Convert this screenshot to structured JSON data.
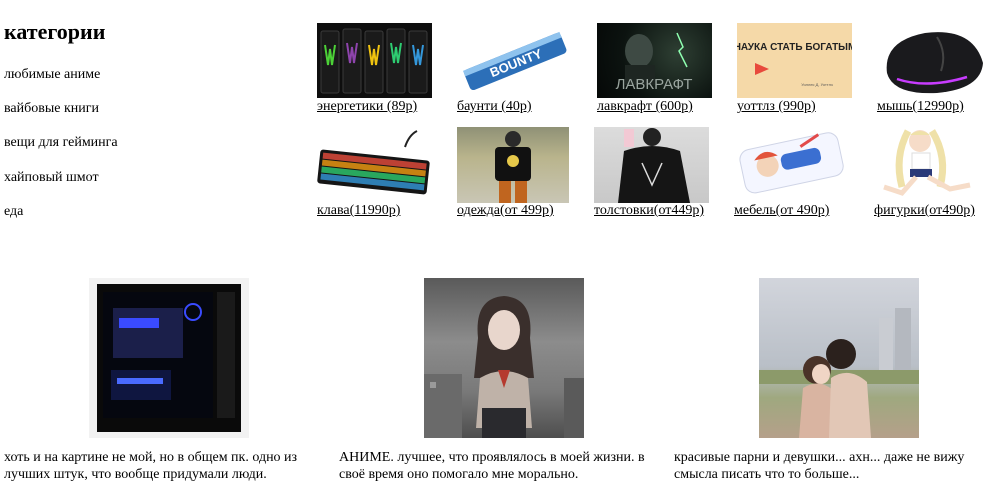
{
  "sidebar": {
    "title": "категории",
    "categories": [
      "любимые аниме",
      "вайбовые книги",
      "вещи для гейминга",
      "хайповый шмот",
      "еда"
    ]
  },
  "products": [
    {
      "label": "энергетики (89р)",
      "image": "energy-drink-cans"
    },
    {
      "label": "баунти (40р)",
      "image": "bounty-bar"
    },
    {
      "label": "лавкрафт (600р)",
      "image": "lovecraft-portrait"
    },
    {
      "label": "уоттлз (990р)",
      "image": "book-cover"
    },
    {
      "label": "мышь(12990р)",
      "image": "gaming-mouse"
    },
    {
      "label": "клава(11990р)",
      "image": "rgb-keyboard"
    },
    {
      "label": "одежда(от 499р)",
      "image": "streetwear-outfit"
    },
    {
      "label": "толстовки(от449р)",
      "image": "black-hoodie"
    },
    {
      "label": "мебель(от 490р)",
      "image": "anime-pillow"
    },
    {
      "label": "фигурки(от490р)",
      "image": "anime-figurine"
    }
  ],
  "book_cover_text": {
    "title": "НАУКА СТАТЬ БОГАТЫМ",
    "author": "Уоллес Д. Уоттлз"
  },
  "lovecraft_cover_text": "ЛАВКРАФТ",
  "bounty_wrapper_text": "BOUNTY",
  "features": [
    {
      "text": "хоть и на картине не мой, но в общем пк. одно из лучших штук, что вообще придумали люди.",
      "image": "gaming-pc"
    },
    {
      "text": "АНИМЕ. лучшее, что проявлялось в моей жизни. в своё время оно помогало мне морально.",
      "image": "anime-girl"
    },
    {
      "text": "красивые парни и девушки... ахн... даже не вижу смысла писать что то больше...",
      "image": "couple"
    }
  ]
}
